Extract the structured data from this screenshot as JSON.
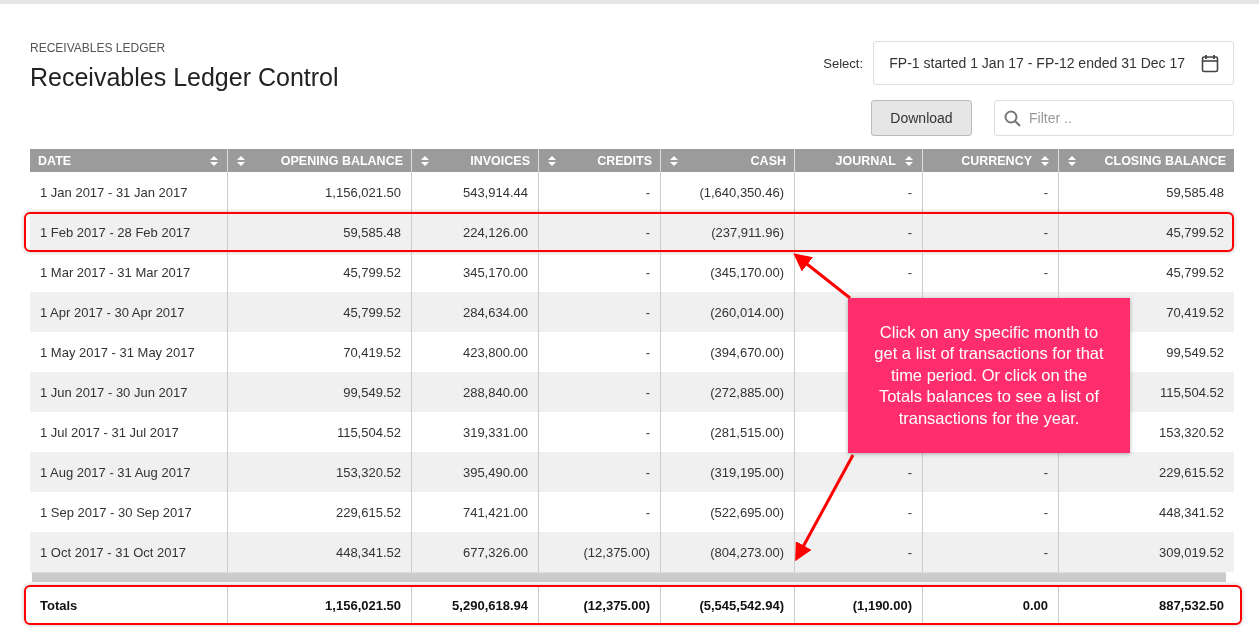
{
  "breadcrumb": "RECEIVABLES LEDGER",
  "title": "Receivables Ledger Control",
  "period_select": {
    "label": "Select:",
    "value": "FP-1 started 1 Jan 17 - FP-12 ended 31 Dec 17"
  },
  "download_button": "Download",
  "filter": {
    "placeholder": "Filter .."
  },
  "table": {
    "columns": [
      {
        "label": "DATE"
      },
      {
        "label": "OPENING BALANCE"
      },
      {
        "label": "INVOICES"
      },
      {
        "label": "CREDITS"
      },
      {
        "label": "CASH"
      },
      {
        "label": "JOURNAL"
      },
      {
        "label": "CURRENCY"
      },
      {
        "label": "CLOSING BALANCE"
      }
    ],
    "rows": [
      {
        "cells": [
          "1 Jan 2017 - 31 Jan 2017",
          "1,156,021.50",
          "543,914.44",
          "-",
          "(1,640,350.46)",
          "-",
          "-",
          "59,585.48"
        ],
        "highlighted": false
      },
      {
        "cells": [
          "1 Feb 2017 - 28 Feb 2017",
          "59,585.48",
          "224,126.00",
          "-",
          "(237,911.96)",
          "-",
          "-",
          "45,799.52"
        ],
        "highlighted": true
      },
      {
        "cells": [
          "1 Mar 2017 - 31 Mar 2017",
          "45,799.52",
          "345,170.00",
          "-",
          "(345,170.00)",
          "-",
          "-",
          "45,799.52"
        ],
        "highlighted": false
      },
      {
        "cells": [
          "1 Apr 2017 - 30 Apr 2017",
          "45,799.52",
          "284,634.00",
          "-",
          "(260,014.00)",
          null,
          null,
          "70,419.52"
        ],
        "highlighted": false
      },
      {
        "cells": [
          "1 May 2017 - 31 May 2017",
          "70,419.52",
          "423,800.00",
          "-",
          "(394,670.00)",
          null,
          null,
          "99,549.52"
        ],
        "highlighted": false
      },
      {
        "cells": [
          "1 Jun 2017 - 30 Jun 2017",
          "99,549.52",
          "288,840.00",
          "-",
          "(272,885.00)",
          null,
          null,
          "115,504.52"
        ],
        "highlighted": false
      },
      {
        "cells": [
          "1 Jul 2017 - 31 Jul 2017",
          "115,504.52",
          "319,331.00",
          "-",
          "(281,515.00)",
          null,
          null,
          "153,320.52"
        ],
        "highlighted": false
      },
      {
        "cells": [
          "1 Aug 2017 - 31 Aug 2017",
          "153,320.52",
          "395,490.00",
          "-",
          "(319,195.00)",
          "-",
          "-",
          "229,615.52"
        ],
        "highlighted": false
      },
      {
        "cells": [
          "1 Sep 2017 - 30 Sep 2017",
          "229,615.52",
          "741,421.00",
          "-",
          "(522,695.00)",
          "-",
          "-",
          "448,341.52"
        ],
        "highlighted": false
      },
      {
        "cells": [
          "1 Oct 2017 - 31 Oct 2017",
          "448,341.52",
          "677,326.00",
          "(12,375.00)",
          "(804,273.00)",
          "-",
          "-",
          "309,019.52"
        ],
        "highlighted": false
      }
    ],
    "totals": {
      "cells": [
        "Totals",
        "1,156,021.50",
        "5,290,618.94",
        "(12,375.00)",
        "(5,545,542.94)",
        "(1,190.00)",
        "0.00",
        "887,532.50"
      ],
      "highlighted": true
    }
  },
  "callout": {
    "text": "Click on any specific month to get a list of transactions for that time period. Or click on the Totals balances to see a list of transactions for the year."
  }
}
